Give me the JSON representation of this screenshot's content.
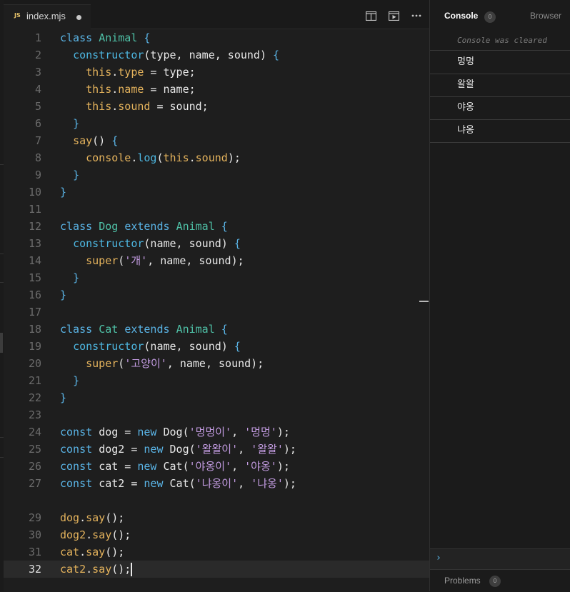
{
  "tab": {
    "badge": "JS",
    "filename": "index.mjs"
  },
  "toolbar": {
    "split_icon": "split-editor-icon",
    "preview_icon": "open-preview-icon",
    "more_icon": "more-actions-icon"
  },
  "editor": {
    "current_line": 32,
    "lines": [
      {
        "n": "1",
        "tokens": [
          [
            "kw",
            "class "
          ],
          [
            "cls",
            "Animal "
          ],
          [
            "br",
            "{"
          ]
        ]
      },
      {
        "n": "2",
        "tokens": [
          [
            "",
            "  "
          ],
          [
            "fnc",
            "constructor"
          ],
          [
            "",
            "(type, name, sound) "
          ],
          [
            "br",
            "{"
          ]
        ]
      },
      {
        "n": "3",
        "tokens": [
          [
            "",
            "    "
          ],
          [
            "thisk",
            "this"
          ],
          [
            "",
            "."
          ],
          [
            "prop",
            "type"
          ],
          [
            "",
            " = type;"
          ]
        ]
      },
      {
        "n": "4",
        "tokens": [
          [
            "",
            "    "
          ],
          [
            "thisk",
            "this"
          ],
          [
            "",
            "."
          ],
          [
            "prop",
            "name"
          ],
          [
            "",
            " = name;"
          ]
        ]
      },
      {
        "n": "5",
        "tokens": [
          [
            "",
            "    "
          ],
          [
            "thisk",
            "this"
          ],
          [
            "",
            "."
          ],
          [
            "prop",
            "sound"
          ],
          [
            "",
            " = sound;"
          ]
        ]
      },
      {
        "n": "6",
        "tokens": [
          [
            "",
            "  "
          ],
          [
            "br",
            "}"
          ]
        ]
      },
      {
        "n": "7",
        "tokens": [
          [
            "",
            "  "
          ],
          [
            "fn",
            "say"
          ],
          [
            "",
            "() "
          ],
          [
            "br",
            "{"
          ]
        ]
      },
      {
        "n": "8",
        "tokens": [
          [
            "",
            "    "
          ],
          [
            "fn",
            "console"
          ],
          [
            "",
            "."
          ],
          [
            "fnc",
            "log"
          ],
          [
            "",
            "("
          ],
          [
            "thisk",
            "this"
          ],
          [
            "",
            "."
          ],
          [
            "prop",
            "sound"
          ],
          [
            "",
            ");"
          ]
        ]
      },
      {
        "n": "9",
        "tokens": [
          [
            "",
            "  "
          ],
          [
            "br",
            "}"
          ]
        ]
      },
      {
        "n": "10",
        "tokens": [
          [
            "br",
            "}"
          ]
        ]
      },
      {
        "n": "11",
        "tokens": []
      },
      {
        "n": "12",
        "tokens": [
          [
            "kw",
            "class "
          ],
          [
            "cls",
            "Dog "
          ],
          [
            "kw",
            "extends "
          ],
          [
            "cls",
            "Animal "
          ],
          [
            "br",
            "{"
          ]
        ]
      },
      {
        "n": "13",
        "tokens": [
          [
            "",
            "  "
          ],
          [
            "fnc",
            "constructor"
          ],
          [
            "",
            "(name, sound) "
          ],
          [
            "br",
            "{"
          ]
        ]
      },
      {
        "n": "14",
        "tokens": [
          [
            "",
            "    "
          ],
          [
            "fn",
            "super"
          ],
          [
            "",
            "("
          ],
          [
            "str",
            "'개'"
          ],
          [
            "",
            ", name, sound);"
          ]
        ]
      },
      {
        "n": "15",
        "tokens": [
          [
            "",
            "  "
          ],
          [
            "br",
            "}"
          ]
        ]
      },
      {
        "n": "16",
        "tokens": [
          [
            "br",
            "}"
          ]
        ]
      },
      {
        "n": "17",
        "tokens": []
      },
      {
        "n": "18",
        "tokens": [
          [
            "kw",
            "class "
          ],
          [
            "cls",
            "Cat "
          ],
          [
            "kw",
            "extends "
          ],
          [
            "cls",
            "Animal "
          ],
          [
            "br",
            "{"
          ]
        ]
      },
      {
        "n": "19",
        "tokens": [
          [
            "",
            "  "
          ],
          [
            "fnc",
            "constructor"
          ],
          [
            "",
            "(name, sound) "
          ],
          [
            "br",
            "{"
          ]
        ]
      },
      {
        "n": "20",
        "tokens": [
          [
            "",
            "    "
          ],
          [
            "fn",
            "super"
          ],
          [
            "",
            "("
          ],
          [
            "str",
            "'고양이'"
          ],
          [
            "",
            ", name, sound);"
          ]
        ]
      },
      {
        "n": "21",
        "tokens": [
          [
            "",
            "  "
          ],
          [
            "br",
            "}"
          ]
        ]
      },
      {
        "n": "22",
        "tokens": [
          [
            "br",
            "}"
          ]
        ]
      },
      {
        "n": "23",
        "tokens": []
      },
      {
        "n": "24",
        "tokens": [
          [
            "kw",
            "const "
          ],
          [
            "",
            "dog = "
          ],
          [
            "kw",
            "new "
          ],
          [
            "",
            "Dog("
          ],
          [
            "str",
            "'멍멍이'"
          ],
          [
            "",
            ", "
          ],
          [
            "str",
            "'멍멍'"
          ],
          [
            "",
            ");"
          ]
        ]
      },
      {
        "n": "25",
        "tokens": [
          [
            "kw",
            "const "
          ],
          [
            "",
            "dog2 = "
          ],
          [
            "kw",
            "new "
          ],
          [
            "",
            "Dog("
          ],
          [
            "str",
            "'왈왈이'"
          ],
          [
            "",
            ", "
          ],
          [
            "str",
            "'왈왈'"
          ],
          [
            "",
            ");"
          ]
        ]
      },
      {
        "n": "26",
        "tokens": [
          [
            "kw",
            "const "
          ],
          [
            "",
            "cat = "
          ],
          [
            "kw",
            "new "
          ],
          [
            "",
            "Cat("
          ],
          [
            "str",
            "'야옹이'"
          ],
          [
            "",
            ", "
          ],
          [
            "str",
            "'야옹'"
          ],
          [
            "",
            ");"
          ]
        ]
      },
      {
        "n": "27",
        "tokens": [
          [
            "kw",
            "const "
          ],
          [
            "",
            "cat2 = "
          ],
          [
            "kw",
            "new "
          ],
          [
            "",
            "Cat("
          ],
          [
            "str",
            "'냐옹이'"
          ],
          [
            "",
            ", "
          ],
          [
            "str",
            "'냐옹'"
          ],
          [
            "",
            ");"
          ]
        ]
      },
      {
        "n": "",
        "tokens": []
      },
      {
        "n": "29",
        "tokens": [
          [
            "fn",
            "dog"
          ],
          [
            "",
            "."
          ],
          [
            "fn",
            "say"
          ],
          [
            "",
            "();"
          ]
        ]
      },
      {
        "n": "30",
        "tokens": [
          [
            "fn",
            "dog2"
          ],
          [
            "",
            "."
          ],
          [
            "fn",
            "say"
          ],
          [
            "",
            "();"
          ]
        ]
      },
      {
        "n": "31",
        "tokens": [
          [
            "fn",
            "cat"
          ],
          [
            "",
            "."
          ],
          [
            "fn",
            "say"
          ],
          [
            "",
            "();"
          ]
        ]
      },
      {
        "n": "32",
        "tokens": [
          [
            "fn",
            "cat2"
          ],
          [
            "",
            "."
          ],
          [
            "fn",
            "say"
          ],
          [
            "",
            "();"
          ]
        ]
      }
    ]
  },
  "console": {
    "title": "Console",
    "badge": "0",
    "browser_tab": "Browser",
    "cleared_text": "Console was cleared",
    "logs": [
      "멍멍",
      "왈왈",
      "야옹",
      "냐옹"
    ],
    "prompt_symbol": "›"
  },
  "problems": {
    "label": "Problems",
    "badge": "0"
  }
}
